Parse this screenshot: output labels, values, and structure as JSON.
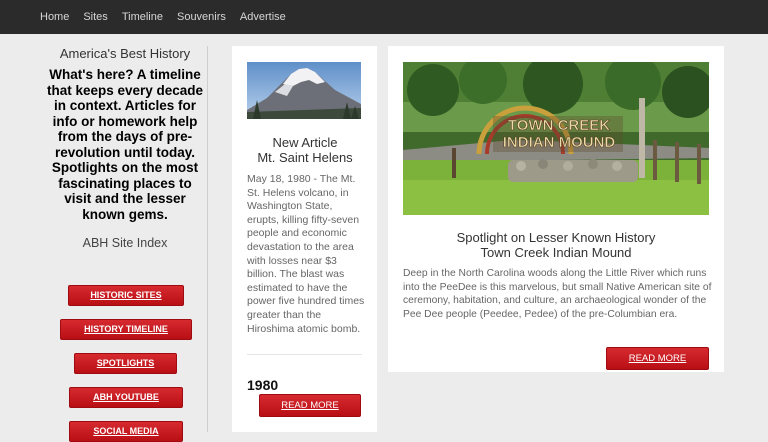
{
  "nav": {
    "items": [
      "Home",
      "Sites",
      "Timeline",
      "Souvenirs",
      "Advertise"
    ]
  },
  "sidebar": {
    "site_title": "America's Best History",
    "intro": "What's here? A timeline that keeps every decade in context. Articles for info or homework help from the days of pre-revolution until today. Spotlights on the most fascinating places to visit and the lesser known gems.",
    "index_title": "ABH Site Index",
    "buttons": [
      "HISTORIC SITES",
      "HISTORY TIMELINE",
      "SPOTLIGHTS",
      "ABH YOUTUBE",
      "SOCIAL MEDIA"
    ]
  },
  "article": {
    "title_line1": "New Article",
    "title_line2": "Mt. Saint Helens",
    "body": "May 18, 1980 - The Mt. St. Helens volcano, in Washington State, erupts, killing fifty-seven people and economic devastation to the area with losses near $3 billion. The blast was estimated to have the power five hundred times greater than the Hiroshima atomic bomb.",
    "year": "1980",
    "read_more": "READ MORE"
  },
  "spotlight": {
    "title_line1": "Spotlight on Lesser Known History",
    "title_line2": "Town Creek Indian Mound",
    "body": "Deep in the North Carolina woods along the Little River which runs into the PeeDee is this marvelous, but small Native American site of ceremony, habitation, and culture, an archaeological wonder of the Pee Dee people (Peedee, Pedee) of the pre-Columbian era.",
    "read_more": "READ MORE",
    "sign_line1": "TOWN CREEK",
    "sign_line2": "INDIAN MOUND"
  },
  "colors": {
    "nav_bg": "#2b2b2b",
    "accent_red": "#c5161d",
    "page_bg": "#ececec"
  }
}
